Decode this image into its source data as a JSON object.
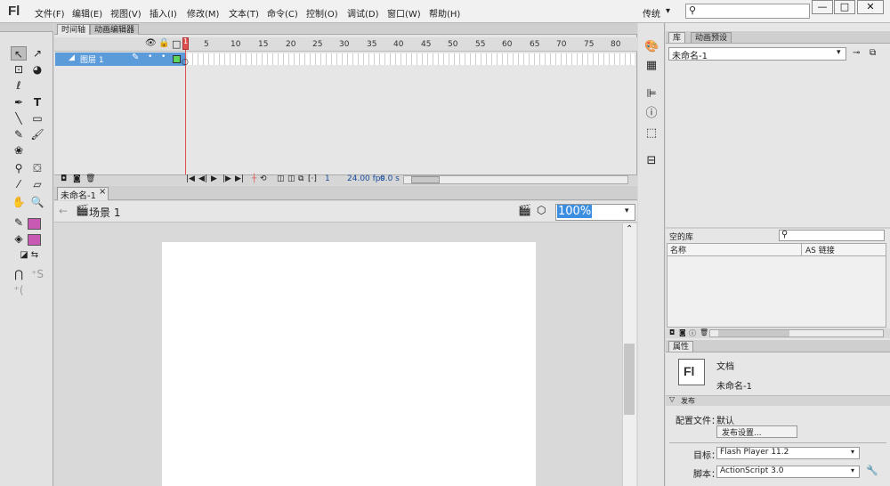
{
  "app": {
    "logo": "Fl"
  },
  "menu": [
    "文件(F)",
    "编辑(E)",
    "视图(V)",
    "插入(I)",
    "修改(M)",
    "文本(T)",
    "命令(C)",
    "控制(O)",
    "调试(D)",
    "窗口(W)",
    "帮助(H)"
  ],
  "workspace": {
    "label": "传统",
    "arrow": "▾"
  },
  "window_controls": {
    "minimize": "—",
    "maximize": "□",
    "close": "✕"
  },
  "timeline": {
    "tabs": [
      "时间轴",
      "动画编辑器"
    ],
    "layer_name": "图层 1",
    "ruler": [
      "5",
      "10",
      "15",
      "20",
      "25",
      "30",
      "35",
      "40",
      "45",
      "50",
      "55",
      "60",
      "65",
      "70",
      "75",
      "80"
    ],
    "frame_num": "1",
    "fps": "24.00 fps",
    "time": "0.0 s"
  },
  "document": {
    "tab_name": "未命名-1",
    "tab_close": "×",
    "scene_label": "场景 1",
    "zoom": "100%"
  },
  "library": {
    "tabs": [
      "库",
      "动画预设"
    ],
    "doc_select": "未命名-1",
    "empty_label": "空的库",
    "col_name": "名称",
    "col_link": "AS 链接"
  },
  "properties": {
    "tab": "属性",
    "icon": "Fl",
    "type": "文档",
    "doc_name": "未命名-1",
    "section": "发布",
    "profile_label": "配置文件：",
    "profile_value": "默认",
    "publish_button": "发布设置...",
    "target_label": "目标：",
    "target_value": "Flash Player 11.2",
    "script_label": "脚本：",
    "script_value": "ActionScript 3.0"
  },
  "colors": {
    "stage": "#ffffff",
    "stroke_swatch": "#c85ab4",
    "fill_swatch": "#c85ab4",
    "layer_select": "#5b9bd9",
    "playhead": "#e05050",
    "zoom_select": "#3b8ee0"
  }
}
